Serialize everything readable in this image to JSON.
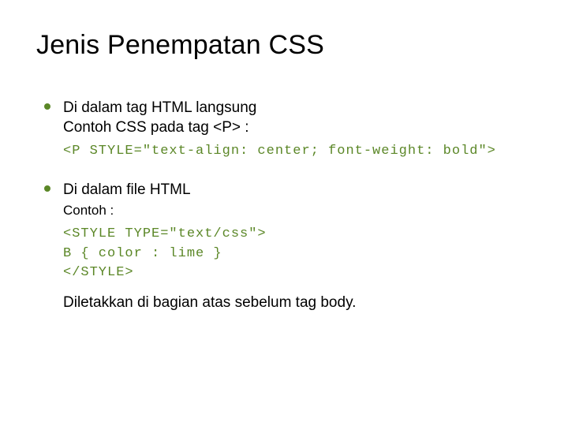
{
  "title": "Jenis Penempatan CSS",
  "items": [
    {
      "line1": "Di dalam tag HTML langsung",
      "line2": "Contoh CSS pada tag <P> :",
      "code": "<P STYLE=\"text-align: center; font-weight: bold\">"
    },
    {
      "line1": "Di dalam file HTML",
      "sub": "Contoh :",
      "code": "<STYLE TYPE=\"text/css\">\nB { color : lime }\n</STYLE>",
      "footnote": "Diletakkan di bagian atas sebelum tag body."
    }
  ]
}
